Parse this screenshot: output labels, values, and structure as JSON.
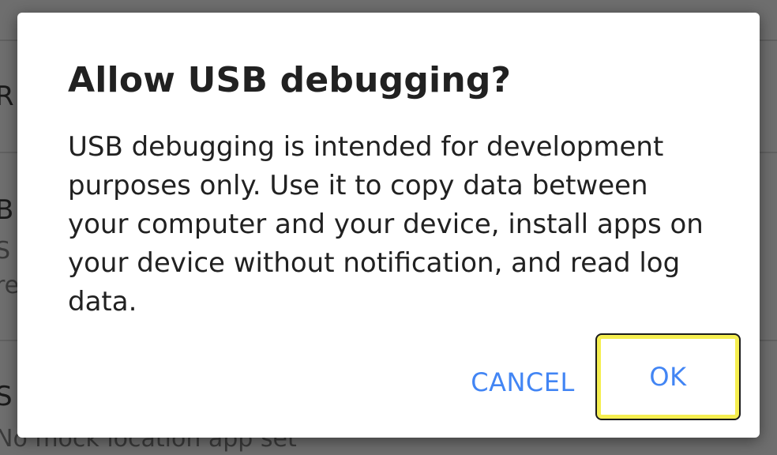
{
  "background": {
    "rows": [
      {
        "title": "R",
        "subtitle": ""
      },
      {
        "title": "B",
        "subtitle": "S"
      },
      {
        "title": "",
        "subtitle": "re"
      },
      {
        "title": "S",
        "subtitle": "No mock location app set"
      }
    ]
  },
  "dialog": {
    "title": "Allow USB debugging?",
    "message": "USB debugging is intended for development purposes only. Use it to copy data between your computer and your device, install apps on your device without notification, and read log data.",
    "cancel_label": "CANCEL",
    "ok_label": "OK"
  },
  "colors": {
    "accent": "#4285f4",
    "focus_highlight": "#f5ee50",
    "scrim": "#6e6e6e"
  }
}
